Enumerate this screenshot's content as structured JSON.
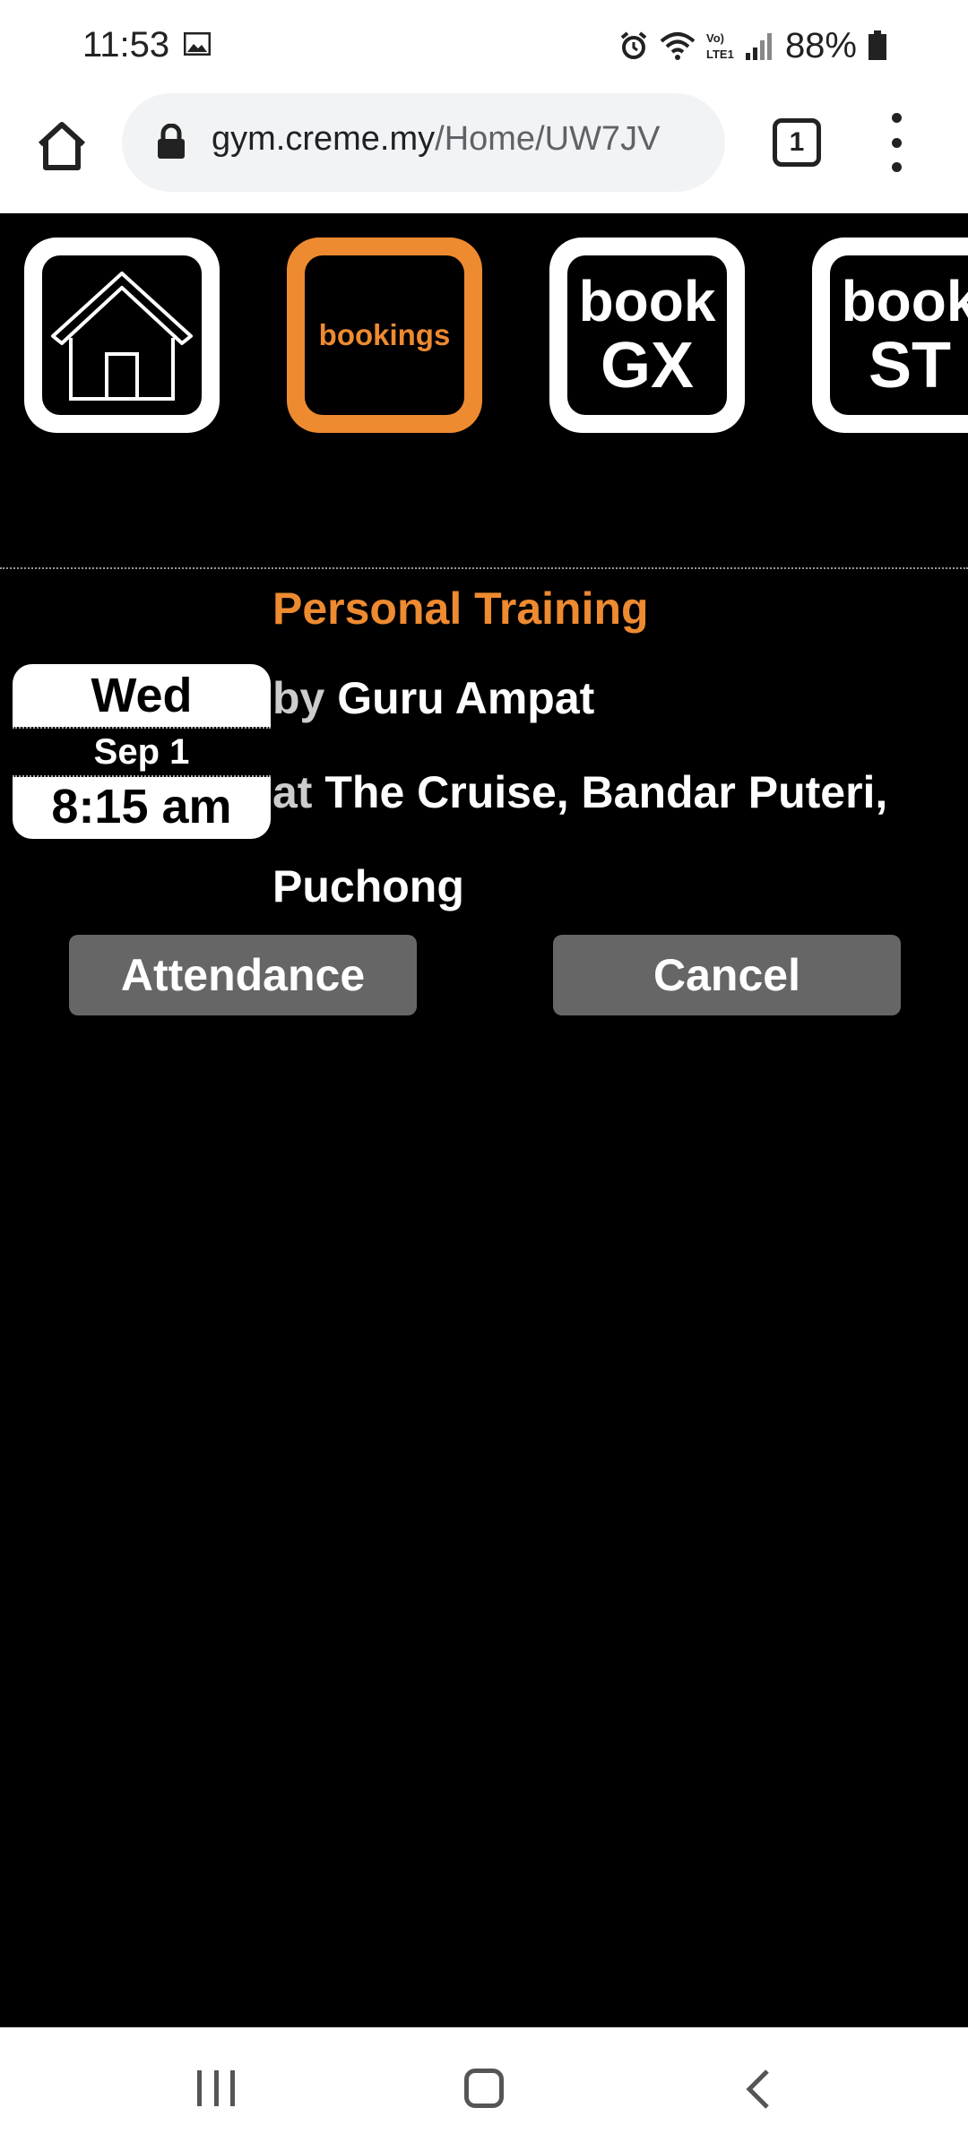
{
  "status_bar": {
    "time": "11:53",
    "battery": "88%",
    "network": "LTE1"
  },
  "browser": {
    "url_domain": "gym.creme.my",
    "url_path": "/Home/UW7JV",
    "tab_count": "1"
  },
  "nav": {
    "bookings_label": "bookings",
    "book_gx_line1": "book",
    "book_gx_line2": "GX",
    "book_st_line1": "book",
    "book_st_line2": "ST"
  },
  "booking": {
    "title": "Personal Training",
    "by_prefix": "by",
    "trainer": "Guru Ampat",
    "at_prefix": "at",
    "location_line1": "The Cruise, Bandar Puteri,",
    "location_line2": "Puchong",
    "day": "Wed",
    "date": "Sep 1",
    "time": "8:15 am"
  },
  "actions": {
    "attendance_label": "Attendance",
    "cancel_label": "Cancel"
  },
  "colors": {
    "accent": "#ee8a30",
    "background": "#000000",
    "button": "#666666"
  }
}
